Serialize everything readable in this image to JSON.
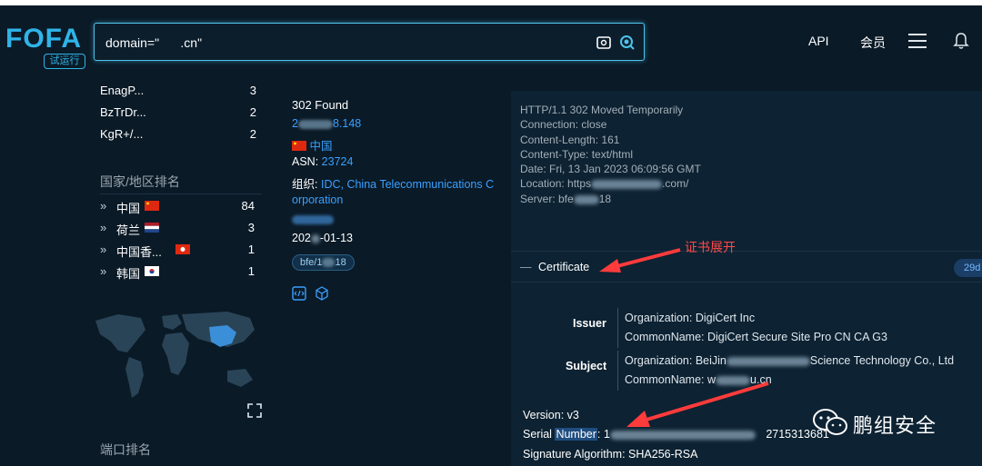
{
  "header": {
    "logo": "FOFA",
    "logo_badge": "试运行",
    "search_value": "domain=\"      .cn\"",
    "nav_api": "API",
    "nav_vip": "会员"
  },
  "sidebar": {
    "stats": [
      {
        "label": "EnagP...",
        "count": "3"
      },
      {
        "label": "BzTrDr...",
        "count": "2"
      },
      {
        "label": "KgR+/...",
        "count": "2"
      }
    ],
    "country_title": "国家/地区排名",
    "countries": [
      {
        "chev": "»",
        "name": "中国",
        "count": "84",
        "flag": "cn"
      },
      {
        "chev": "»",
        "name": "荷兰",
        "count": "3",
        "flag": "nl"
      },
      {
        "chev": "»",
        "name": "中国香...",
        "count": "1",
        "flag": "hk"
      },
      {
        "chev": "»",
        "name": "韩国",
        "count": "1",
        "flag": "kr"
      }
    ],
    "port_title": "端口排名"
  },
  "result": {
    "status": "302 Found",
    "ip_prefix": "2",
    "ip_suffix": "8.148",
    "country": "中国",
    "asn_label": "ASN:",
    "asn_value": "23724",
    "org_label": "组织:",
    "org_line1": "IDC, China Telecommunications C",
    "org_line2": "orporation",
    "date_prefix": "202",
    "date_suffix": "-01-13",
    "tag_prefix": "bfe/1",
    "tag_suffix": "18"
  },
  "http": {
    "lines": [
      "HTTP/1.1 302 Moved Temporarily",
      "Connection: close",
      "Content-Length: 161",
      "Content-Type: text/html",
      "Date: Fri, 13 Jan 2023 06:09:56 GMT"
    ],
    "location_prefix": "Location: https",
    "location_suffix": ".com/",
    "server_prefix": "Server: bfe",
    "server_suffix": "18"
  },
  "certificate": {
    "toggle": "—",
    "title": "Certificate",
    "badge": "29d",
    "annotation": "证书展开",
    "issuer_label": "Issuer",
    "issuer_org": "Organization: DigiCert Inc",
    "issuer_cn": "CommonName: DigiCert Secure Site Pro CN CA G3",
    "subject_label": "Subject",
    "subject_org_prefix": "Organization: BeiJin",
    "subject_org_suffix": "Science Technology Co., Ltd",
    "subject_cn_prefix": "CommonName: w",
    "subject_cn_suffix": "u.cn",
    "version": "Version: v3",
    "serial_label": "Serial",
    "serial_highlight": "Number",
    "serial_colon": ":",
    "serial_prefix": "1",
    "serial_suffix": "2715313681",
    "sig_alg": "Signature Algorithm: SHA256-RSA"
  },
  "watermark": {
    "text": "鹏组安全"
  },
  "colors": {
    "accent": "#2fb4e8",
    "link": "#3aa0ff",
    "annotation": "#ff4a4a",
    "background": "#0a1a27"
  }
}
